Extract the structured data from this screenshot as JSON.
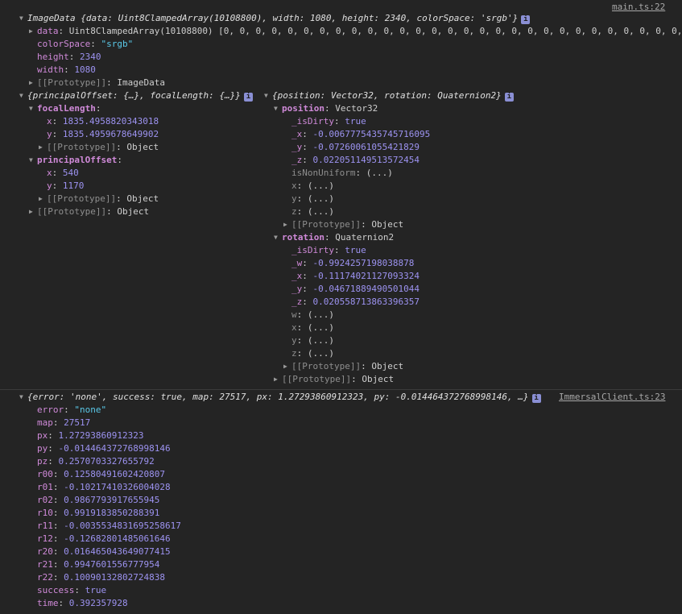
{
  "msg1": {
    "source": "main.ts:22",
    "image_header": "ImageData {data: Uint8ClampedArray(10108800), width: 1080, height: 2340, colorSpace: 'srgb'}",
    "image": {
      "data_key": "data",
      "data_value": "Uint8ClampedArray(10108800) [0, 0, 0, 0, 0, 0, 0, 0, 0, 0, 0, 0, 0, 0, 0, 0, 0, 0, 0, 0, 0, 0, 0, 0, 0, 0, 0, 0, 0, 0, …",
      "colorSpace_key": "colorSpace",
      "colorSpace_value": "\"srgb\"",
      "height_key": "height",
      "height_value": "2340",
      "width_key": "width",
      "width_value": "1080",
      "proto_key": "[[Prototype]]",
      "proto_value": "ImageData"
    },
    "intrinsics_header": "{principalOffset: {…}, focalLength: {…}}",
    "intrinsics": {
      "focal_key": "focalLength",
      "focal_x_key": "x",
      "focal_x_value": "1835.4958820343018",
      "focal_y_key": "y",
      "focal_y_value": "1835.4959678649902",
      "focal_proto_key": "[[Prototype]]",
      "focal_proto_value": "Object",
      "offset_key": "principalOffset",
      "offset_x_key": "x",
      "offset_x_value": "540",
      "offset_y_key": "y",
      "offset_y_value": "1170",
      "offset_proto_key": "[[Prototype]]",
      "offset_proto_value": "Object",
      "proto_key": "[[Prototype]]",
      "proto_value": "Object"
    },
    "pose_header": "{position: Vector32, rotation: Quaternion2}",
    "pose": {
      "position_key": "position",
      "position_type": "Vector32",
      "pos_dirty_key": "_isDirty",
      "pos_dirty_value": "true",
      "pos_x_key": "_x",
      "pos_x_value": "-0.0067775435745716095",
      "pos_y_key": "_y",
      "pos_y_value": "-0.07260061055421829",
      "pos_z_key": "_z",
      "pos_z_value": "0.022051149513572454",
      "pos_nonuniform_key": "isNonUniform",
      "pos_nonuniform_value": "(...)",
      "pos_gx_key": "x",
      "pos_gx_value": "(...)",
      "pos_gy_key": "y",
      "pos_gy_value": "(...)",
      "pos_gz_key": "z",
      "pos_gz_value": "(...)",
      "pos_proto_key": "[[Prototype]]",
      "pos_proto_value": "Object",
      "rotation_key": "rotation",
      "rotation_type": "Quaternion2",
      "rot_dirty_key": "_isDirty",
      "rot_dirty_value": "true",
      "rot_w_key": "_w",
      "rot_w_value": "-0.9924257198038878",
      "rot_x_key": "_x",
      "rot_x_value": "-0.11174021127093324",
      "rot_y_key": "_y",
      "rot_y_value": "-0.04671889490501044",
      "rot_z_key": "_z",
      "rot_z_value": "0.020558713863396357",
      "rot_gw_key": "w",
      "rot_gw_value": "(...)",
      "rot_gx_key": "x",
      "rot_gx_value": "(...)",
      "rot_gy_key": "y",
      "rot_gy_value": "(...)",
      "rot_gz_key": "z",
      "rot_gz_value": "(...)",
      "rot_proto_key": "[[Prototype]]",
      "rot_proto_value": "Object",
      "proto_key": "[[Prototype]]",
      "proto_value": "Object"
    }
  },
  "msg2": {
    "source": "ImmersalClient.ts:23",
    "header": "{error: 'none', success: true, map: 27517, px: 1.27293860912323, py: -0.014464372768998146, …}",
    "rows": [
      {
        "key": "error",
        "value": "\"none\"",
        "kind": "str"
      },
      {
        "key": "map",
        "value": "27517",
        "kind": "num"
      },
      {
        "key": "px",
        "value": "1.27293860912323",
        "kind": "num"
      },
      {
        "key": "py",
        "value": "-0.014464372768998146",
        "kind": "num"
      },
      {
        "key": "pz",
        "value": "0.2570703327655792",
        "kind": "num"
      },
      {
        "key": "r00",
        "value": "0.12580491602420807",
        "kind": "num"
      },
      {
        "key": "r01",
        "value": "-0.10217410326004028",
        "kind": "num"
      },
      {
        "key": "r02",
        "value": "0.9867793917655945",
        "kind": "num"
      },
      {
        "key": "r10",
        "value": "0.9919183850288391",
        "kind": "num"
      },
      {
        "key": "r11",
        "value": "-0.0035534831695258617",
        "kind": "num"
      },
      {
        "key": "r12",
        "value": "-0.12682801485061646",
        "kind": "num"
      },
      {
        "key": "r20",
        "value": "0.016465043649077415",
        "kind": "num"
      },
      {
        "key": "r21",
        "value": "0.9947601556777954",
        "kind": "num"
      },
      {
        "key": "r22",
        "value": "0.10090132802724838",
        "kind": "num"
      },
      {
        "key": "success",
        "value": "true",
        "kind": "num"
      },
      {
        "key": "time",
        "value": "0.392357928",
        "kind": "num"
      }
    ]
  },
  "icons": {
    "info_glyph": "i",
    "expanded_glyph": "▼",
    "collapsed_glyph": "▶"
  }
}
